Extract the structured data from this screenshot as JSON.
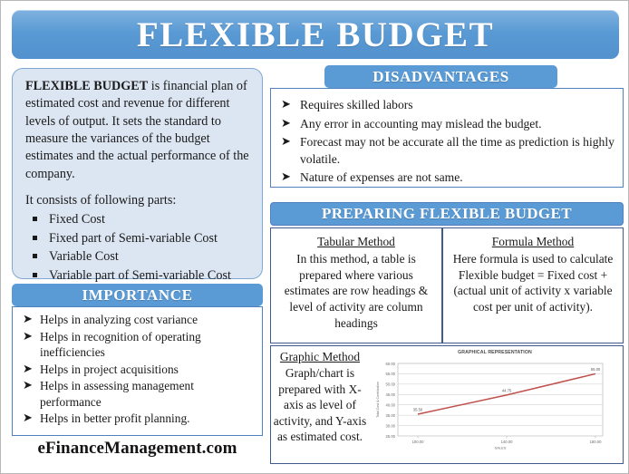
{
  "title": "FLEXIBLE BUDGET",
  "definition": {
    "lead_bold": "FLEXIBLE BUDGET",
    "lead_rest": " is financial plan of estimated cost and revenue for different levels of output. It sets the standard to measure the variances of the budget estimates and the actual performance of the company.",
    "parts_lead": "It consists of following parts:",
    "parts": [
      "Fixed Cost",
      "Fixed part of Semi-variable Cost",
      "Variable Cost",
      "Variable part of Semi-variable Cost"
    ]
  },
  "importance": {
    "header": "IMPORTANCE",
    "items": [
      "Helps in analyzing cost variance",
      "Helps in recognition of operating inefficiencies",
      "Helps in project acquisitions",
      "Helps in assessing management performance",
      "Helps in better profit planning."
    ]
  },
  "disadvantages": {
    "header": "DISADVANTAGES",
    "items": [
      "Requires skilled labors",
      "Any error in accounting may mislead the budget.",
      "Forecast may not be accurate all the time as prediction is highly volatile.",
      "Nature of expenses are not same."
    ]
  },
  "preparing": {
    "header": "PREPARING FLEXIBLE BUDGET",
    "tabular": {
      "title": "Tabular Method",
      "body": "In this method, a table is prepared where various estimates are row headings & level of activity are column headings"
    },
    "formula": {
      "title": "Formula Method",
      "body": "Here formula is used to calculate Flexible budget = Fixed cost + (actual unit of activity x variable cost per unit of activity)."
    },
    "graphic": {
      "title": "Graphic Method",
      "body": "Graph/chart is prepared with X-axis as level of activity, and Y-axis as estimated cost."
    }
  },
  "brand": "eFinanceManagement.com",
  "colors": {
    "header_blue": "#5b9bd5",
    "panel_fill": "#dce6f2",
    "panel_border": "#4f81bd",
    "chart_line": "#c0504d"
  },
  "chart_data": {
    "type": "line",
    "title": "GRAPHICAL REPRESENTATION",
    "xlabel": "SALES",
    "ylabel": "Total Cost & Contribution",
    "x": [
      100.0,
      140.0,
      180.0
    ],
    "xtick_labels": [
      "100.00",
      "140.00",
      "180.00"
    ],
    "values": [
      35.5,
      44.75,
      55.0
    ],
    "point_labels": [
      "35.50",
      "44.75",
      "55.00"
    ],
    "ytick_labels": [
      "60.00",
      "55.00",
      "50.00",
      "45.00",
      "40.00",
      "35.00",
      "30.00",
      "25.00"
    ],
    "ylim": [
      25.0,
      60.0
    ],
    "grid": true,
    "legend": "none"
  }
}
